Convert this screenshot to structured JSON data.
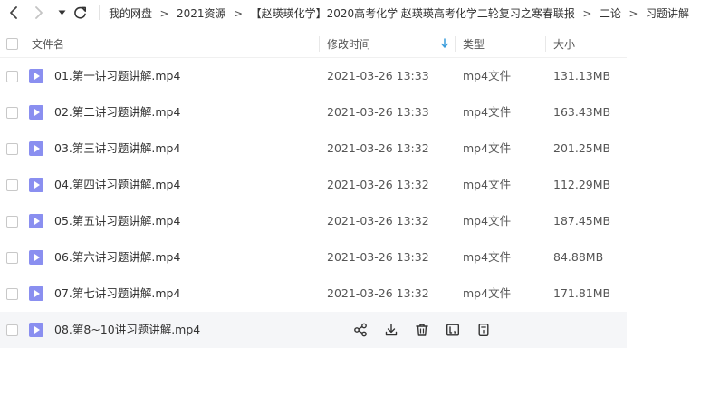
{
  "breadcrumb": {
    "items": [
      "我的网盘",
      "2021资源",
      "【赵瑛瑛化学】2020高考化学 赵瑛瑛高考化学二轮复习之寒春联报",
      "二论",
      "习题讲解"
    ],
    "separator": ">"
  },
  "table": {
    "columns": {
      "name": "文件名",
      "time": "修改时间",
      "type": "类型",
      "size": "大小"
    },
    "sort": {
      "column": "修改时间",
      "direction": "descending"
    },
    "rows": [
      {
        "name": "01.第一讲习题讲解.mp4",
        "time": "2021-03-26 13:33",
        "type": "mp4文件",
        "size": "131.13MB"
      },
      {
        "name": "02.第二讲习题讲解.mp4",
        "time": "2021-03-26 13:33",
        "type": "mp4文件",
        "size": "163.43MB"
      },
      {
        "name": "03.第三讲习题讲解.mp4",
        "time": "2021-03-26 13:32",
        "type": "mp4文件",
        "size": "201.25MB"
      },
      {
        "name": "04.第四讲习题讲解.mp4",
        "time": "2021-03-26 13:32",
        "type": "mp4文件",
        "size": "112.29MB"
      },
      {
        "name": "05.第五讲习题讲解.mp4",
        "time": "2021-03-26 13:32",
        "type": "mp4文件",
        "size": "187.45MB"
      },
      {
        "name": "06.第六讲习题讲解.mp4",
        "time": "2021-03-26 13:32",
        "type": "mp4文件",
        "size": "84.88MB"
      },
      {
        "name": "07.第七讲习题讲解.mp4",
        "time": "2021-03-26 13:32",
        "type": "mp4文件",
        "size": "171.81MB"
      },
      {
        "name": "08.第8~10讲习题讲解.mp4"
      }
    ],
    "hovered_row_actions": [
      "share-icon",
      "download-icon",
      "delete-icon",
      "text-extract-icon",
      "more-icon"
    ]
  },
  "colors": {
    "video_icon": "#8a8ff0",
    "sort_arrow": "#3b9ddc",
    "hover_row": "#f5f6f8"
  }
}
